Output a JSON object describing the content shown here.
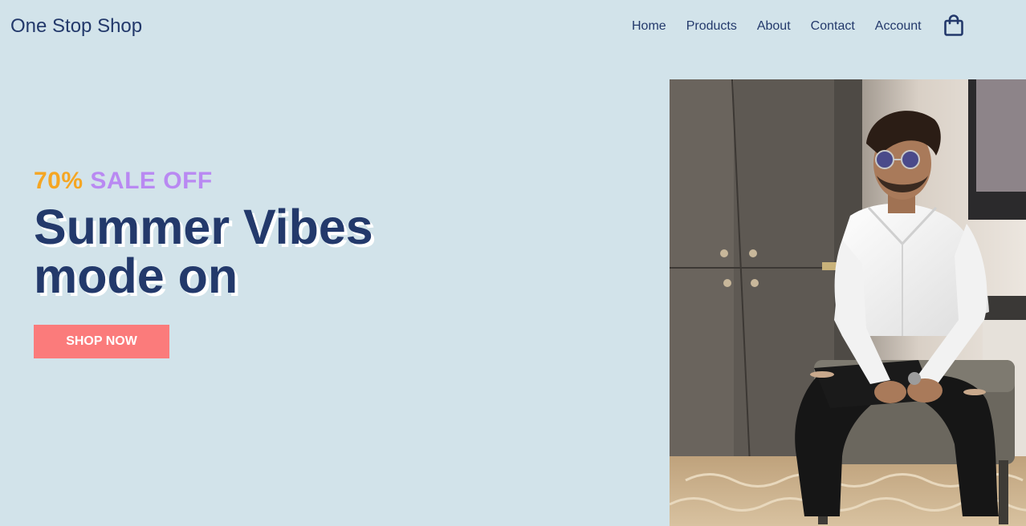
{
  "header": {
    "logo": "One Stop Shop",
    "nav": [
      "Home",
      "Products",
      "About",
      "Contact",
      "Account"
    ],
    "cart_icon": "shopping-bag-icon"
  },
  "hero": {
    "sale_percent": "70%",
    "sale_text": "SALE OFF",
    "headline_line1": "Summer Vibes",
    "headline_line2": "mode on",
    "cta_label": "SHOP NOW",
    "image_description": "man in white shirt and sunglasses sitting"
  },
  "colors": {
    "background": "#d2e3ea",
    "navy": "#23396b",
    "orange": "#f5a623",
    "lavender": "#b989f2",
    "button": "#fb7b7b"
  }
}
